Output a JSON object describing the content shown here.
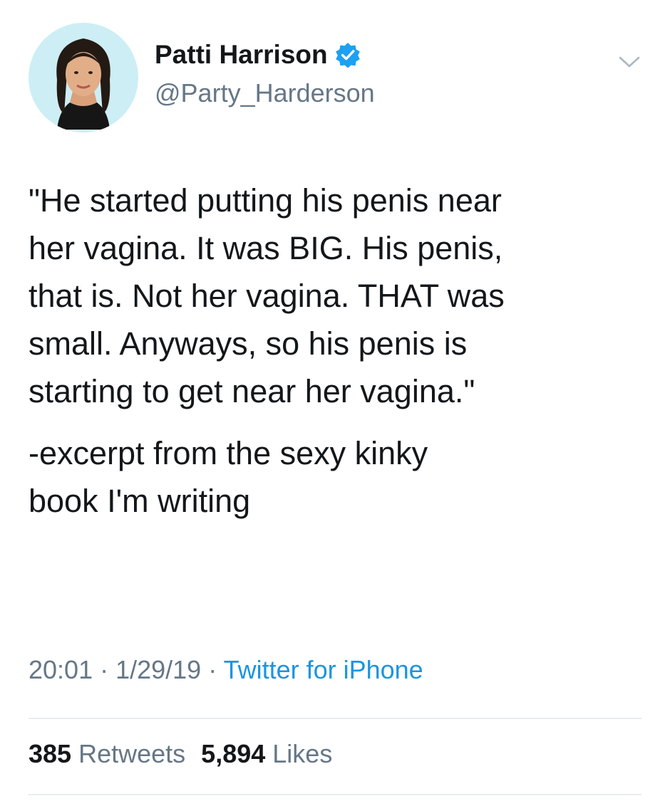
{
  "author": {
    "display_name": "Patti Harrison",
    "handle": "@Party_Harderson",
    "verified": true,
    "avatar_icon": "profile-photo-avatar"
  },
  "tweet": {
    "lines_p1": [
      "\"He started putting his penis near",
      "her vagina. It was BIG. His penis,",
      "that is. Not her vagina. THAT was",
      "small. Anyways, so his penis is",
      "starting to get near her vagina.\""
    ],
    "lines_p2": [
      "-excerpt from the sexy kinky",
      "book I'm writing"
    ]
  },
  "meta": {
    "time": "20:01",
    "separator": " · ",
    "date": "1/29/19",
    "source": "Twitter for iPhone"
  },
  "stats": {
    "retweets_count": "385",
    "retweets_label": "Retweets",
    "likes_count": "5,894",
    "likes_label": "Likes"
  },
  "colors": {
    "text": "#14171a",
    "secondary": "#657786",
    "link": "#1b95e0",
    "verified": "#1da1f2",
    "divider": "#e6ecf0"
  }
}
